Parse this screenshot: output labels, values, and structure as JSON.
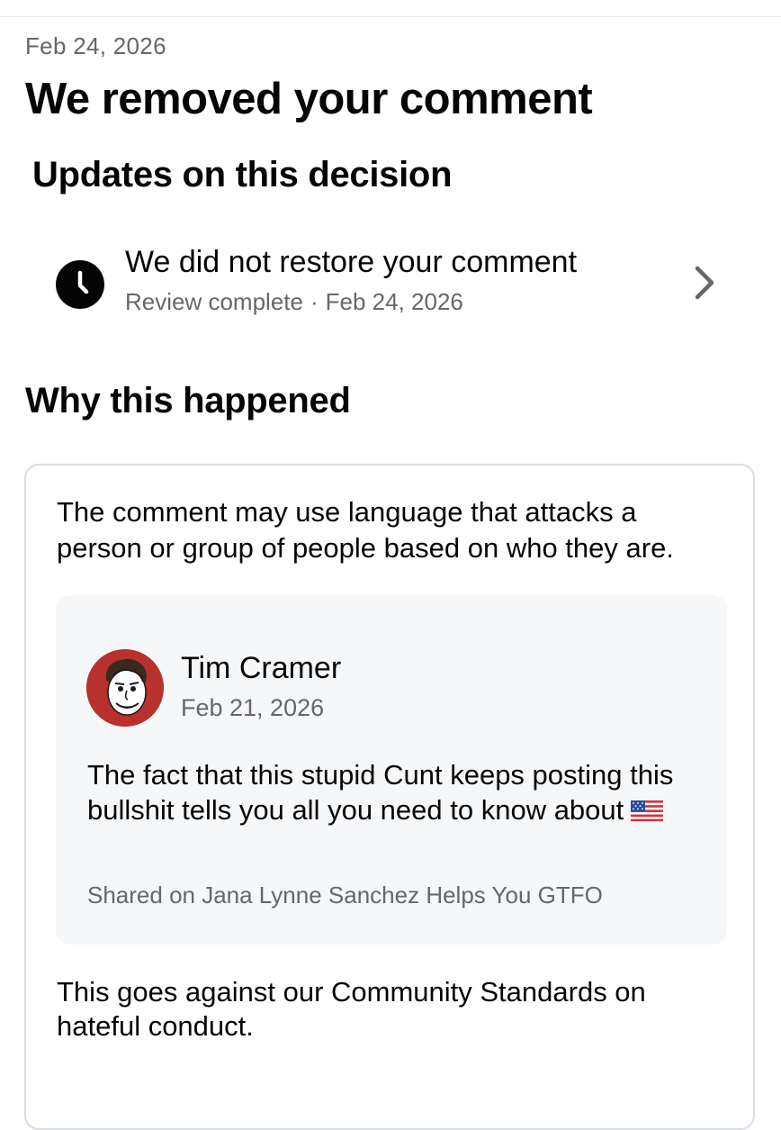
{
  "header": {
    "date": "Feb 24, 2026",
    "title": "We removed your comment"
  },
  "updates": {
    "section_title": "Updates on this decision",
    "item": {
      "icon": "clock-icon",
      "title": "We did not restore your comment",
      "status": "Review complete",
      "separator": "·",
      "date": "Feb 24, 2026",
      "action_icon": "chevron-right-icon"
    }
  },
  "why": {
    "section_title": "Why this happened",
    "reason": "The comment may use language that attacks a person or group of people based on who they are.",
    "comment": {
      "author": "Tim Cramer",
      "date": "Feb 21, 2026",
      "text": "The fact that this stupid Cunt keeps posting this bullshit tells you all you need to know about",
      "emoji": "us-flag-icon",
      "shared_on": "Shared on Jana Lynne Sanchez Helps You GTFO"
    },
    "standards": "This goes against our Community Standards on hateful conduct."
  },
  "colors": {
    "text_primary": "#050505",
    "text_secondary": "#65676b",
    "card_border": "#dadde1",
    "comment_background": "#f6f7f9",
    "avatar_background": "#b8312f"
  }
}
